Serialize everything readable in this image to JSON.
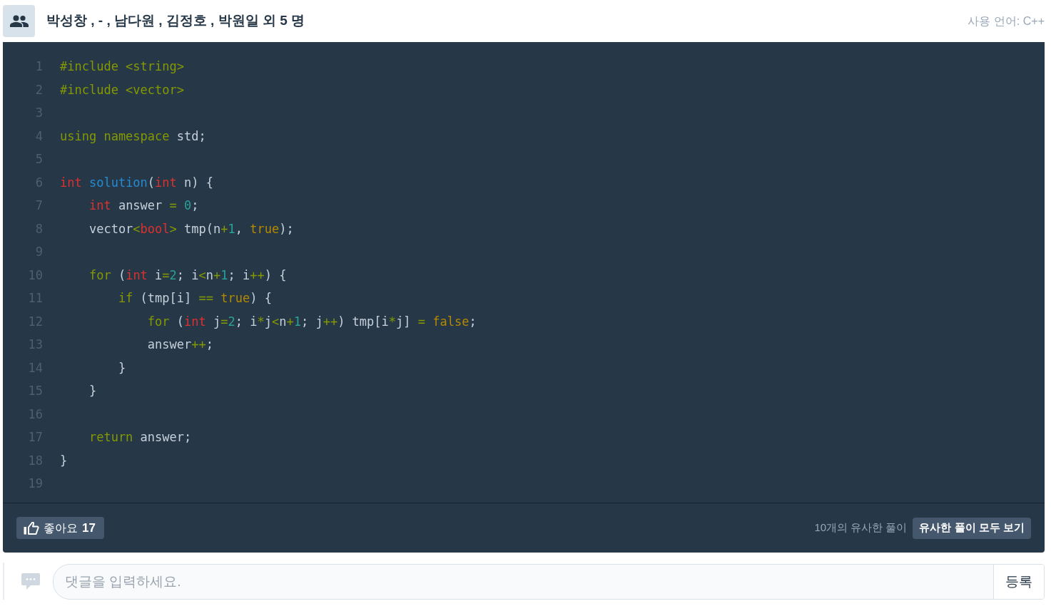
{
  "header": {
    "title": "박성창 , - , 남다원 , 김정호 , 박원일 외 5 명",
    "language": "사용 언어: C++"
  },
  "code": {
    "lines": [
      {
        "number": "1",
        "tokens": [
          {
            "kind": "pre",
            "text": "#include <string>"
          }
        ]
      },
      {
        "number": "2",
        "tokens": [
          {
            "kind": "pre",
            "text": "#include <vector>"
          }
        ]
      },
      {
        "number": "3"
      },
      {
        "number": "4",
        "tokens": [
          {
            "kind": "keyword",
            "text": "using namespace"
          },
          {
            "kind": "plain",
            "text": " std;"
          }
        ]
      },
      {
        "number": "5"
      },
      {
        "number": "6",
        "tokens": [
          {
            "kind": "type",
            "text": "int"
          },
          {
            "kind": "func",
            "text": " solution"
          },
          {
            "kind": "plain",
            "text": "("
          },
          {
            "kind": "type",
            "text": "int"
          },
          {
            "kind": "plain",
            "text": " n) {"
          }
        ]
      },
      {
        "number": "7",
        "tokens": [
          {
            "kind": "type",
            "text": "    int"
          },
          {
            "kind": "plain",
            "text": " answer "
          },
          {
            "kind": "op",
            "text": "="
          },
          {
            "kind": "num",
            "text": " 0"
          },
          {
            "kind": "plain",
            "text": ";"
          }
        ]
      },
      {
        "number": "8",
        "tokens": [
          {
            "kind": "plain",
            "text": "    vector"
          },
          {
            "kind": "op",
            "text": "<"
          },
          {
            "kind": "type",
            "text": "bool"
          },
          {
            "kind": "op",
            "text": ">"
          },
          {
            "kind": "plain",
            "text": " tmp(n"
          },
          {
            "kind": "op",
            "text": "+"
          },
          {
            "kind": "num",
            "text": "1"
          },
          {
            "kind": "plain",
            "text": ", "
          },
          {
            "kind": "lit",
            "text": "true"
          },
          {
            "kind": "plain",
            "text": ");"
          }
        ]
      },
      {
        "number": "9"
      },
      {
        "number": "10",
        "tokens": [
          {
            "kind": "keyword",
            "text": "    for"
          },
          {
            "kind": "plain",
            "text": " ("
          },
          {
            "kind": "type",
            "text": "int"
          },
          {
            "kind": "plain",
            "text": " i"
          },
          {
            "kind": "op",
            "text": "="
          },
          {
            "kind": "num",
            "text": "2"
          },
          {
            "kind": "plain",
            "text": "; i"
          },
          {
            "kind": "op",
            "text": "<"
          },
          {
            "kind": "plain",
            "text": "n"
          },
          {
            "kind": "op",
            "text": "+"
          },
          {
            "kind": "num",
            "text": "1"
          },
          {
            "kind": "plain",
            "text": "; i"
          },
          {
            "kind": "op",
            "text": "++"
          },
          {
            "kind": "plain",
            "text": ") {"
          }
        ]
      },
      {
        "number": "11",
        "tokens": [
          {
            "kind": "keyword",
            "text": "        if"
          },
          {
            "kind": "plain",
            "text": " (tmp[i] "
          },
          {
            "kind": "op",
            "text": "=="
          },
          {
            "kind": "lit",
            "text": " true"
          },
          {
            "kind": "plain",
            "text": ") {"
          }
        ]
      },
      {
        "number": "12",
        "tokens": [
          {
            "kind": "keyword",
            "text": "            for"
          },
          {
            "kind": "plain",
            "text": " ("
          },
          {
            "kind": "type",
            "text": "int"
          },
          {
            "kind": "plain",
            "text": " j"
          },
          {
            "kind": "op",
            "text": "="
          },
          {
            "kind": "num",
            "text": "2"
          },
          {
            "kind": "plain",
            "text": "; i"
          },
          {
            "kind": "op",
            "text": "*"
          },
          {
            "kind": "plain",
            "text": "j"
          },
          {
            "kind": "op",
            "text": "<"
          },
          {
            "kind": "plain",
            "text": "n"
          },
          {
            "kind": "op",
            "text": "+"
          },
          {
            "kind": "num",
            "text": "1"
          },
          {
            "kind": "plain",
            "text": "; j"
          },
          {
            "kind": "op",
            "text": "++"
          },
          {
            "kind": "plain",
            "text": ") tmp[i"
          },
          {
            "kind": "op",
            "text": "*"
          },
          {
            "kind": "plain",
            "text": "j] "
          },
          {
            "kind": "op",
            "text": "="
          },
          {
            "kind": "lit",
            "text": " false"
          },
          {
            "kind": "plain",
            "text": ";"
          }
        ]
      },
      {
        "number": "13",
        "tokens": [
          {
            "kind": "plain",
            "text": "            answer"
          },
          {
            "kind": "op",
            "text": "++"
          },
          {
            "kind": "plain",
            "text": ";"
          }
        ]
      },
      {
        "number": "14",
        "tokens": [
          {
            "kind": "plain",
            "text": "        }"
          }
        ]
      },
      {
        "number": "15",
        "tokens": [
          {
            "kind": "plain",
            "text": "    }"
          }
        ]
      },
      {
        "number": "16"
      },
      {
        "number": "17",
        "tokens": [
          {
            "kind": "keyword",
            "text": "    return"
          },
          {
            "kind": "plain",
            "text": " answer;"
          }
        ]
      },
      {
        "number": "18",
        "tokens": [
          {
            "kind": "plain",
            "text": "}"
          }
        ]
      },
      {
        "number": "19"
      }
    ]
  },
  "footer": {
    "like_label": "좋아요",
    "like_count": "17",
    "similar_count": "10개의 유사한 풀이",
    "similar_button": "유사한 풀이 모두 보기"
  },
  "comment": {
    "placeholder": "댓글을 입력하세요.",
    "submit": "등록"
  }
}
